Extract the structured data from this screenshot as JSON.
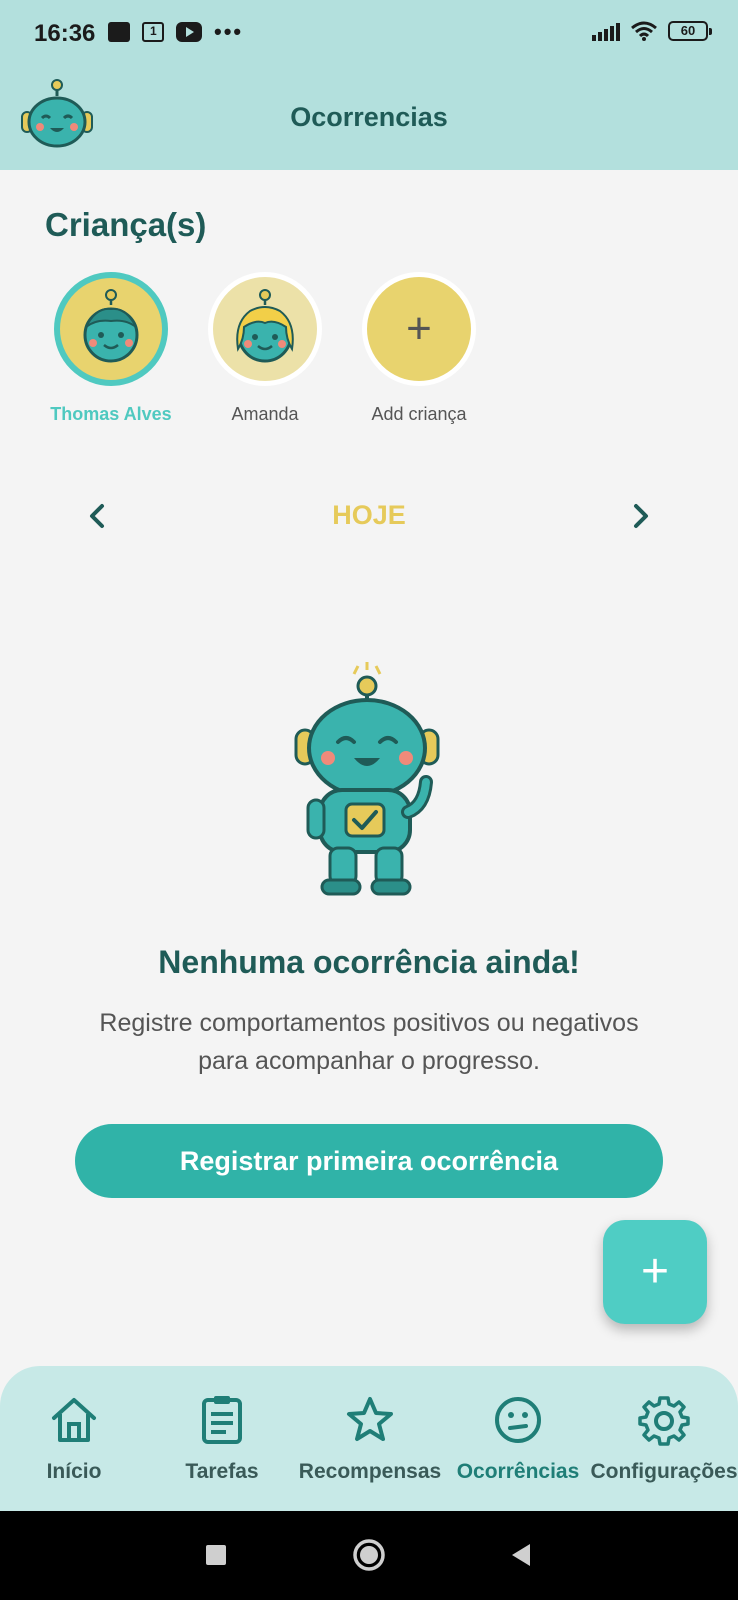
{
  "status_bar": {
    "time": "16:36",
    "calendar_day": "1",
    "more": "•••",
    "battery": "60"
  },
  "app_bar": {
    "title": "Ocorrencias",
    "logo": "robot-logo-icon"
  },
  "children_section": {
    "title": "Criança(s)",
    "children": [
      {
        "name": "Thomas Alves",
        "selected": true,
        "avatar": "boy-robot-avatar"
      },
      {
        "name": "Amanda",
        "selected": false,
        "avatar": "girl-robot-avatar"
      }
    ],
    "add_label": "Add criança",
    "add_symbol": "+"
  },
  "date_nav": {
    "label": "HOJE",
    "prev_icon": "chevron-left-icon",
    "next_icon": "chevron-right-icon"
  },
  "empty_state": {
    "title": "Nenhuma ocorrência ainda!",
    "text": "Registre comportamentos positivos ou negativos para acompanhar o progresso.",
    "button": "Registrar primeira ocorrência",
    "illustration": "robot-mascot-icon"
  },
  "fab": {
    "symbol": "+",
    "icon": "plus-icon"
  },
  "bottom_nav": {
    "items": [
      {
        "label": "Início",
        "icon": "home-icon",
        "active": false
      },
      {
        "label": "Tarefas",
        "icon": "clipboard-icon",
        "active": false
      },
      {
        "label": "Recompensas",
        "icon": "star-icon",
        "active": false
      },
      {
        "label": "Ocorrências",
        "icon": "face-icon",
        "active": true
      },
      {
        "label": "Configurações",
        "icon": "gear-icon",
        "active": false
      }
    ]
  },
  "colors": {
    "primary": "#30b3a8",
    "accent": "#4fc9c0",
    "header": "#b3e0dd",
    "yellow": "#e6ca5a",
    "dark_text": "#1f5b57"
  }
}
